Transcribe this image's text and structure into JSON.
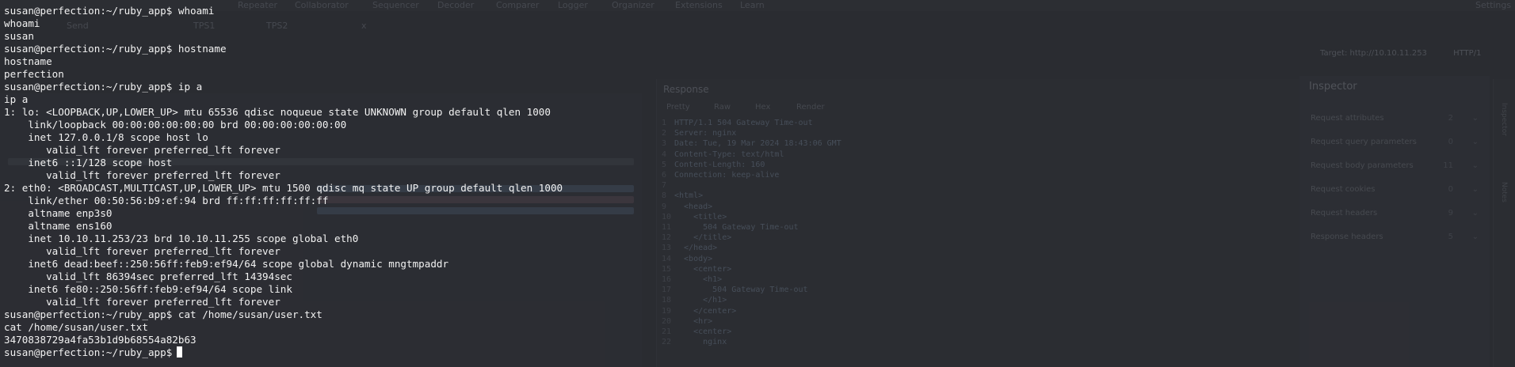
{
  "background_app": {
    "menu": [
      "Repeater",
      "Collaborator",
      "Sequencer",
      "Decoder",
      "Comparer",
      "Logger",
      "Organizer",
      "Extensions",
      "Learn"
    ],
    "settings_label": "Settings",
    "tabs": [
      "Send",
      "TPS1",
      "TPS2",
      "x"
    ],
    "target_label": "Target: http://10.10.11.253",
    "protocol_label": "HTTP/1",
    "response": {
      "title": "Response",
      "tabs": [
        "Pretty",
        "Raw",
        "Hex",
        "Render"
      ],
      "lines": [
        "HTTP/1.1 504 Gateway Time-out",
        "Server: nginx",
        "Date: Tue, 19 Mar 2024 18:43:06 GMT",
        "Content-Type: text/html",
        "Content-Length: 160",
        "Connection: keep-alive",
        "",
        "<html>",
        "  <head>",
        "    <title>",
        "      504 Gateway Time-out",
        "    </title>",
        "  </head>",
        "  <body>",
        "    <center>",
        "      <h1>",
        "        504 Gateway Time-out",
        "      </h1>",
        "    </center>",
        "    <hr>",
        "    <center>",
        "      nginx"
      ]
    },
    "inspector": {
      "title": "Inspector",
      "rows": [
        {
          "label": "Request attributes",
          "count": "2"
        },
        {
          "label": "Request query parameters",
          "count": "0"
        },
        {
          "label": "Request body parameters",
          "count": "11"
        },
        {
          "label": "Request cookies",
          "count": "0"
        },
        {
          "label": "Request headers",
          "count": "9"
        },
        {
          "label": "Response headers",
          "count": "5"
        }
      ]
    },
    "sidebar": [
      "Inspector",
      "Notes"
    ]
  },
  "terminal": {
    "lines": [
      "susan@perfection:~/ruby_app$ whoami",
      "whoami",
      "susan",
      "susan@perfection:~/ruby_app$ hostname",
      "hostname",
      "perfection",
      "susan@perfection:~/ruby_app$ ip a",
      "ip a",
      "1: lo: <LOOPBACK,UP,LOWER_UP> mtu 65536 qdisc noqueue state UNKNOWN group default qlen 1000",
      "    link/loopback 00:00:00:00:00:00 brd 00:00:00:00:00:00",
      "    inet 127.0.0.1/8 scope host lo",
      "       valid_lft forever preferred_lft forever",
      "    inet6 ::1/128 scope host",
      "       valid_lft forever preferred_lft forever",
      "2: eth0: <BROADCAST,MULTICAST,UP,LOWER_UP> mtu 1500 qdisc mq state UP group default qlen 1000",
      "    link/ether 00:50:56:b9:ef:94 brd ff:ff:ff:ff:ff:ff",
      "    altname enp3s0",
      "    altname ens160",
      "    inet 10.10.11.253/23 brd 10.10.11.255 scope global eth0",
      "       valid_lft forever preferred_lft forever",
      "    inet6 dead:beef::250:56ff:feb9:ef94/64 scope global dynamic mngtmpaddr",
      "       valid_lft 86394sec preferred_lft 14394sec",
      "    inet6 fe80::250:56ff:feb9:ef94/64 scope link",
      "       valid_lft forever preferred_lft forever",
      "susan@perfection:~/ruby_app$ cat /home/susan/user.txt",
      "cat /home/susan/user.txt",
      "3470838729a4fa53b1d9b68554a82b63"
    ],
    "prompt": "susan@perfection:~/ruby_app$"
  }
}
